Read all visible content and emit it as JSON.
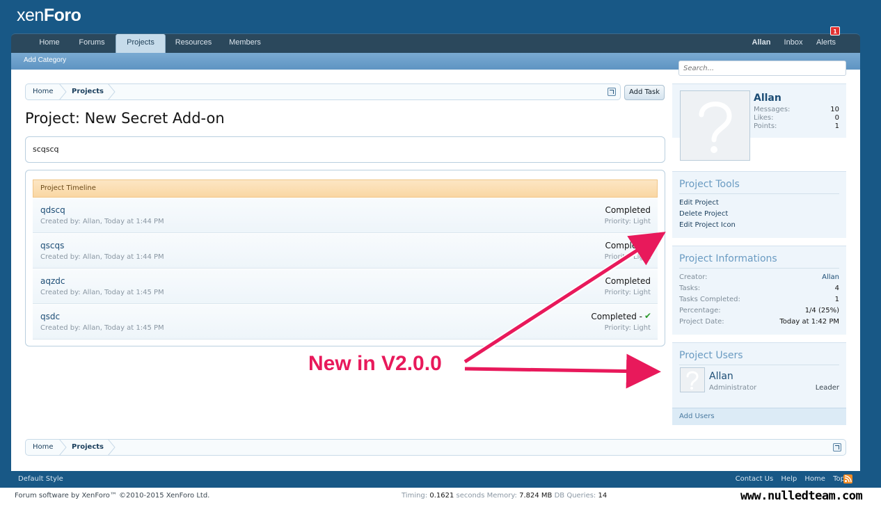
{
  "logo": {
    "text1": "xen",
    "text2": "Foro"
  },
  "nav": {
    "tabs": [
      "Home",
      "Forums",
      "Projects",
      "Resources",
      "Members"
    ],
    "right": [
      "Allan",
      "Inbox",
      "Alerts"
    ],
    "alert_count": "1",
    "sub_link": "Add Category"
  },
  "search": {
    "placeholder": "Search..."
  },
  "breadcrumb": [
    "Home",
    "Projects"
  ],
  "add_task": "Add Task",
  "page_title": "Project: New Secret Add-on",
  "description": "scqscq",
  "timeline": {
    "header": "Project Timeline",
    "tasks": [
      {
        "name": "qdscq",
        "meta": "Created by: Allan, Today at 1:44 PM",
        "status": "Completed",
        "priority": "Priority: Light"
      },
      {
        "name": "qscqs",
        "meta": "Created by: Allan, Today at 1:44 PM",
        "status": "Completed",
        "priority": "Priority: Light"
      },
      {
        "name": "aqzdc",
        "meta": "Created by: Allan, Today at 1:45 PM",
        "status": "Completed",
        "priority": "Priority: Light"
      },
      {
        "name": "qsdc",
        "meta": "Created by: Allan, Today at 1:45 PM",
        "status": "Completed -",
        "priority": "Priority: Light"
      }
    ]
  },
  "user_card": {
    "name": "Allan",
    "stats": [
      {
        "label": "Messages:",
        "value": "10"
      },
      {
        "label": "Likes:",
        "value": "0"
      },
      {
        "label": "Points:",
        "value": "1"
      }
    ]
  },
  "project_tools": {
    "title": "Project Tools",
    "links": [
      "Edit Project",
      "Delete Project",
      "Edit Project Icon"
    ]
  },
  "project_info": {
    "title": "Project Informations",
    "rows": [
      {
        "label": "Creator:",
        "value": "Allan"
      },
      {
        "label": "Tasks:",
        "value": "4"
      },
      {
        "label": "Tasks Completed:",
        "value": "1"
      },
      {
        "label": "Percentage:",
        "value": "1/4 (25%)"
      },
      {
        "label": "Project Date:",
        "value": "Today at 1:42 PM"
      }
    ]
  },
  "project_users": {
    "title": "Project Users",
    "user": {
      "name": "Allan",
      "role": "Administrator",
      "rank": "Leader"
    },
    "add_link": "Add Users"
  },
  "footer": {
    "style": "Default Style",
    "links": [
      "Contact Us",
      "Help",
      "Home",
      "Top"
    ],
    "copyright": "Forum software by XenForo™ ©2010-2015 XenForo Ltd.",
    "timing_label": "Timing:",
    "timing_value": "0.1621",
    "seconds_label": "seconds Memory:",
    "memory_value": "7.824 MB",
    "queries_label": "DB Queries:",
    "queries_value": "14"
  },
  "annotation": "New in V2.0.0",
  "watermark": "www.nulledteam.com",
  "colors": {
    "brand": "#185886",
    "annotation": "#e8195b",
    "check": "#2b9a2b"
  }
}
